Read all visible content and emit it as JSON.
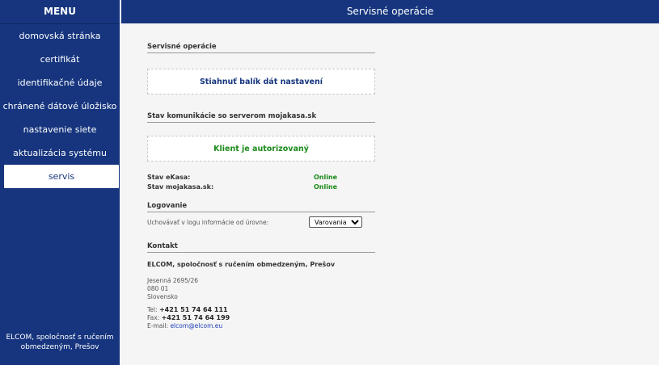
{
  "sidebar": {
    "title": "MENU",
    "items": [
      {
        "label": "domovská stránka"
      },
      {
        "label": "certifikát"
      },
      {
        "label": "identifikačné údaje"
      },
      {
        "label": "chránené dátové úložisko"
      },
      {
        "label": "nastavenie siete"
      },
      {
        "label": "aktualizácia systému"
      },
      {
        "label": "servis",
        "active": true
      }
    ],
    "footer": "ELCOM, spoločnosť s ručením obmedzeným, Prešov"
  },
  "header": {
    "title": "Servisné operácie"
  },
  "service_ops": {
    "title": "Servisné operácie",
    "download_button": "Stiahnuť balík dát nastavení"
  },
  "server_comm": {
    "title": "Stav komunikácie so serverom mojakasa.sk",
    "status": "Klient je autorizovaný",
    "rows": [
      {
        "label": "Stav eKasa:",
        "value": "Online"
      },
      {
        "label": "Stav mojakasa.sk:",
        "value": "Online"
      }
    ]
  },
  "logging": {
    "title": "Logovanie",
    "label": "Uchovávať v logu informácie od úrovne:",
    "selected": "Varovania"
  },
  "contact": {
    "title": "Kontakt",
    "company": "ELCOM, spoločnosť s ručením obmedzeným, Prešov",
    "street": "Jesenná 2695/26",
    "zip": "080 01",
    "country": "Slovensko",
    "tel_label": "Tel:",
    "tel": "+421 51 74 64 111",
    "fax_label": "Fax:",
    "fax": "+421 51 74 64 199",
    "email_label": "E-mail:",
    "email": "elcom@elcom.eu"
  },
  "colors": {
    "brand": "#16357e",
    "status_ok": "#1a8a1a",
    "button_text": "#16357e"
  }
}
